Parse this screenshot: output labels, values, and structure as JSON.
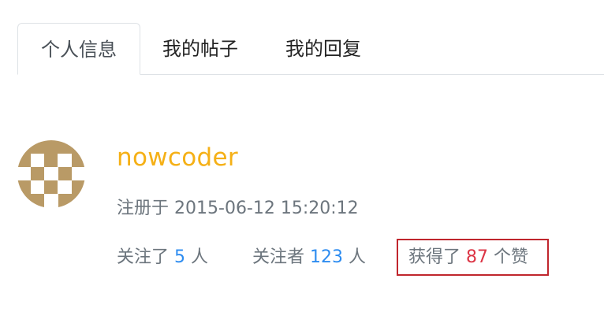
{
  "tabs": [
    {
      "label": "个人信息",
      "active": true
    },
    {
      "label": "我的帖子",
      "active": false
    },
    {
      "label": "我的回复",
      "active": false
    }
  ],
  "profile": {
    "username": "nowcoder",
    "register_prefix": "注册于",
    "register_time": "2015-06-12 15:20:12",
    "following_prefix": "关注了",
    "following_count": "5",
    "following_suffix": "人",
    "followers_prefix": "关注者",
    "followers_count": "123",
    "followers_suffix": "人",
    "likes_prefix": "获得了",
    "likes_count": "87",
    "likes_suffix": "个赞"
  },
  "colors": {
    "username": "#f5b016",
    "link_number": "#2d8cf0",
    "likes_number": "#dc3545",
    "highlight_border": "#c0262d",
    "avatar": "#b99a66"
  },
  "icons": {
    "avatar": "identicon-avatar"
  }
}
